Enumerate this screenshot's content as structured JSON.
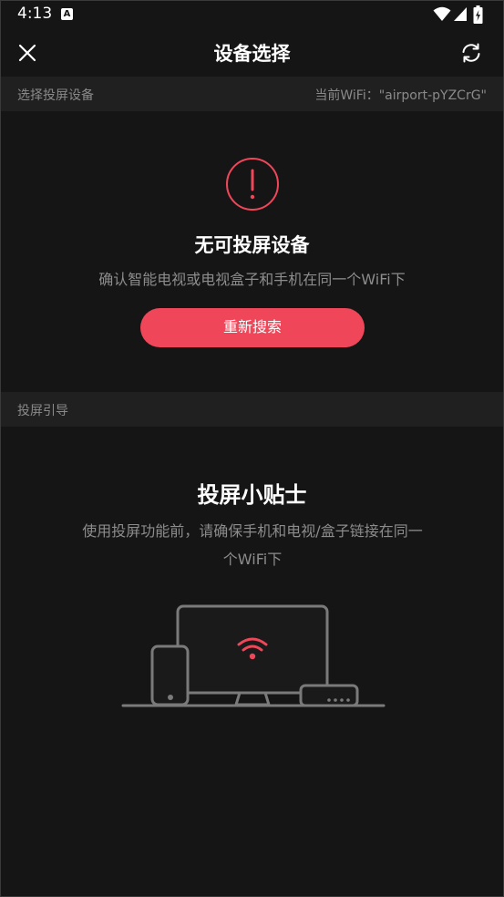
{
  "status_bar": {
    "time": "4:13",
    "notification_badge": "A",
    "icons": [
      "wifi-icon",
      "signal-icon",
      "battery-charging-icon"
    ]
  },
  "header": {
    "title": "设备选择",
    "left_icon": "close-icon",
    "right_icon": "refresh-icon"
  },
  "device_section": {
    "label": "选择投屏设备",
    "current_wifi": "当前WiFi：\"airport-pYZCrG\""
  },
  "empty_state": {
    "icon": "alert-circle-icon",
    "title": "无可投屏设备",
    "description": "确认智能电视或电视盒子和手机在同一个WiFi下",
    "button_label": "重新搜索"
  },
  "guide_section": {
    "label": "投屏引导"
  },
  "tips": {
    "title": "投屏小贴士",
    "line1": "使用投屏功能前，请确保手机和电视/盒子链接在同一",
    "line2": "个WiFi下",
    "illustration": "devices-wifi-illustration"
  },
  "colors": {
    "accent": "#f0465a",
    "background": "#151515",
    "section_bar": "#202020",
    "muted_text": "#8c8c8c"
  }
}
